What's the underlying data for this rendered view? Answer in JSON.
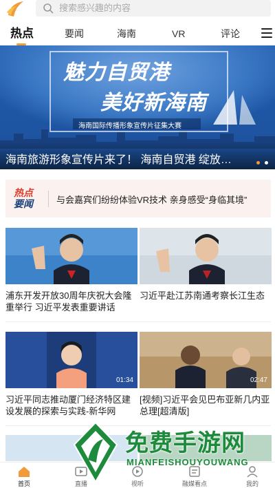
{
  "search": {
    "placeholder": "搜索感兴趣的内容"
  },
  "tabs": [
    {
      "label": "热点",
      "active": true
    },
    {
      "label": "要闻"
    },
    {
      "label": "海南"
    },
    {
      "label": "VR"
    },
    {
      "label": "评论"
    }
  ],
  "banner": {
    "calligraphy_line1": "魅力自贸港",
    "calligraphy_line2": "美好新海南",
    "subtitle": "海南国际传播形象宣传片征集大赛",
    "caption": "海南旅游形象宣传片来了！ 海南自贸港 绽放新...",
    "slide_count": 3,
    "active_slide": 0
  },
  "hot_news": {
    "badge_line1": "热点",
    "badge_line2": "要闻",
    "text": "与会嘉宾们纷纷体验VR技术 亲身感受“身临其境”"
  },
  "news": [
    {
      "title": "浦东开发开放30周年庆祝大会隆重举行 习近平发表重要讲话",
      "duration": ""
    },
    {
      "title": "习近平赴江苏南通考察长江生态",
      "duration": ""
    },
    {
      "title": "习近平同志推动厦门经济特区建设发展的探索与实践-新华网",
      "duration": "01:34"
    },
    {
      "title": "[视频]习近平会见巴布亚新几内亚总理[超清版]",
      "duration": "02:47"
    }
  ],
  "bottom_nav": [
    {
      "label": "首页",
      "icon": "home-icon",
      "active": true
    },
    {
      "label": "直播",
      "icon": "live-icon"
    },
    {
      "label": "视听",
      "icon": "video-icon"
    },
    {
      "label": "融媒看点",
      "icon": "media-icon"
    },
    {
      "label": "我的",
      "icon": "profile-icon"
    }
  ],
  "watermark": {
    "title": "免费手游网",
    "subtitle": "MIANFEISHOUYOUWANG"
  },
  "colors": {
    "accent": "#f29b3a",
    "hot_red": "#e03b2b",
    "hot_blue": "#1a3f7a",
    "watermark_green": "#1e8a3c"
  }
}
